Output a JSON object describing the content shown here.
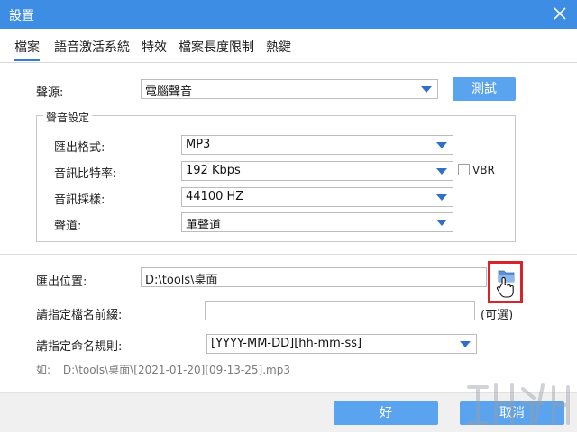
{
  "window": {
    "title": "設置"
  },
  "tabs": [
    {
      "label": "檔案",
      "active": true
    },
    {
      "label": "語音激活系統",
      "active": false
    },
    {
      "label": "特效",
      "active": false
    },
    {
      "label": "檔案長度限制",
      "active": false
    },
    {
      "label": "熱鍵",
      "active": false
    }
  ],
  "source": {
    "label": "聲源:",
    "value": "電腦聲音",
    "test_button": "測試"
  },
  "sound_settings": {
    "group_title": "聲音設定",
    "format": {
      "label": "匯出格式:",
      "value": "MP3"
    },
    "bitrate": {
      "label": "音訊比特率:",
      "value": "192 Kbps"
    },
    "vbr": {
      "label": "VBR",
      "checked": false
    },
    "sample_rate": {
      "label": "音訊採樣:",
      "value": "44100 HZ"
    },
    "channel": {
      "label": "聲道:",
      "value": "單聲道"
    }
  },
  "output": {
    "location_label": "匯出位置:",
    "location_value": "D:\\tools\\桌面",
    "prefix_label": "請指定檔名前綴:",
    "prefix_value": "",
    "optional_label": "(可選)",
    "naming_label": "請指定命名規則:",
    "naming_value": "[YYYY-MM-DD][hh-mm-ss]",
    "example_prefix": "如:",
    "example_value": "D:\\tools\\桌面\\[2021-01-20][09-13-25].mp3"
  },
  "footer": {
    "ok_label": "好",
    "cancel_label": "取消"
  },
  "colors": {
    "titlebar": "#3d8de4",
    "button": "#5aa3ee",
    "highlight": "#d9232b"
  }
}
